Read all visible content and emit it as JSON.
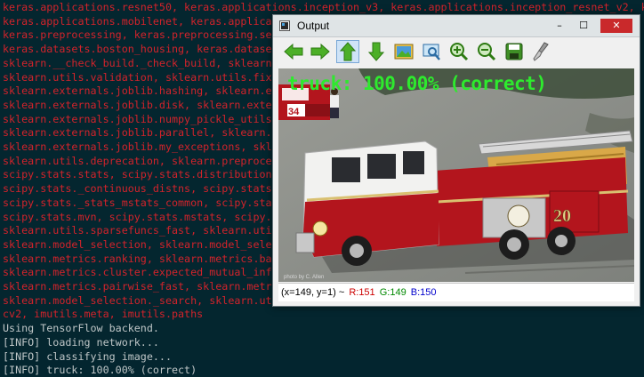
{
  "terminal": {
    "lines": [
      "keras.applications.resnet50, keras.applications.inception_v3, keras.applications.inception_resnet_v2, ke",
      "keras.applications.mobilenet, keras.applications",
      "keras.preprocessing, keras.preprocessing.se",
      "keras.datasets.boston_housing, keras.datase",
      "sklearn.__check_build._check_build, sklearn",
      "sklearn.utils.validation, sklearn.utils.fix",
      "sklearn.externals.joblib.hashing, sklearn.e",
      "sklearn.externals.joblib.disk, sklearn.exte",
      "sklearn.externals.joblib.numpy_pickle_utils",
      "sklearn.externals.joblib.parallel, sklearn.",
      "sklearn.externals.joblib.my_exceptions, skl",
      "sklearn.utils.deprecation, sklearn.preproce",
      "scipy.stats.stats, scipy.stats.distribution",
      "scipy.stats._continuous_distns, scipy.stats",
      "scipy.stats._stats_mstats_common, scipy.sta",
      "scipy.stats.mvn, scipy.stats.mstats, scipy.",
      "sklearn.utils.sparsefuncs_fast, sklearn.uti",
      "sklearn.model_selection, sklearn.model_sele",
      "sklearn.metrics.ranking, sklearn.metrics.ba",
      "sklearn.metrics.cluster.expected_mutual_inf",
      "sklearn.metrics.pairwise_fast, sklearn.metr",
      "sklearn.model_selection._search, sklearn.ut",
      "cv2, imutils.meta, imutils.paths"
    ],
    "log_lines": [
      "Using TensorFlow backend.",
      "[INFO] loading network...",
      "[INFO] classifying image...",
      "[INFO] truck: 100.00% (correct)"
    ],
    "error_color": "#d3232b",
    "log_color": "#bfc6c7"
  },
  "window": {
    "title": "Output",
    "minimize_label": "–",
    "maximize_label": "☐",
    "close_label": "✕"
  },
  "toolbar": {
    "icons": [
      "arrow-left-icon",
      "arrow-right-icon",
      "arrow-up-icon",
      "arrow-down-icon",
      "image-icon",
      "zoom-fit-icon",
      "zoom-in-icon",
      "zoom-out-icon",
      "save-icon",
      "brush-icon"
    ]
  },
  "image": {
    "prediction": "truck: 100.00% (correct)",
    "vehicle_number": "20",
    "vehicle_number_small": "34",
    "photo_credit": "photo by C. Allen"
  },
  "status": {
    "coords": "(x=149, y=1) ~",
    "r": "R:151",
    "g": "G:149",
    "b": "B:150"
  },
  "colors": {
    "label_green": "#2eea2e",
    "truck_red": "#b3151d",
    "pavement": "#8b8e88"
  }
}
